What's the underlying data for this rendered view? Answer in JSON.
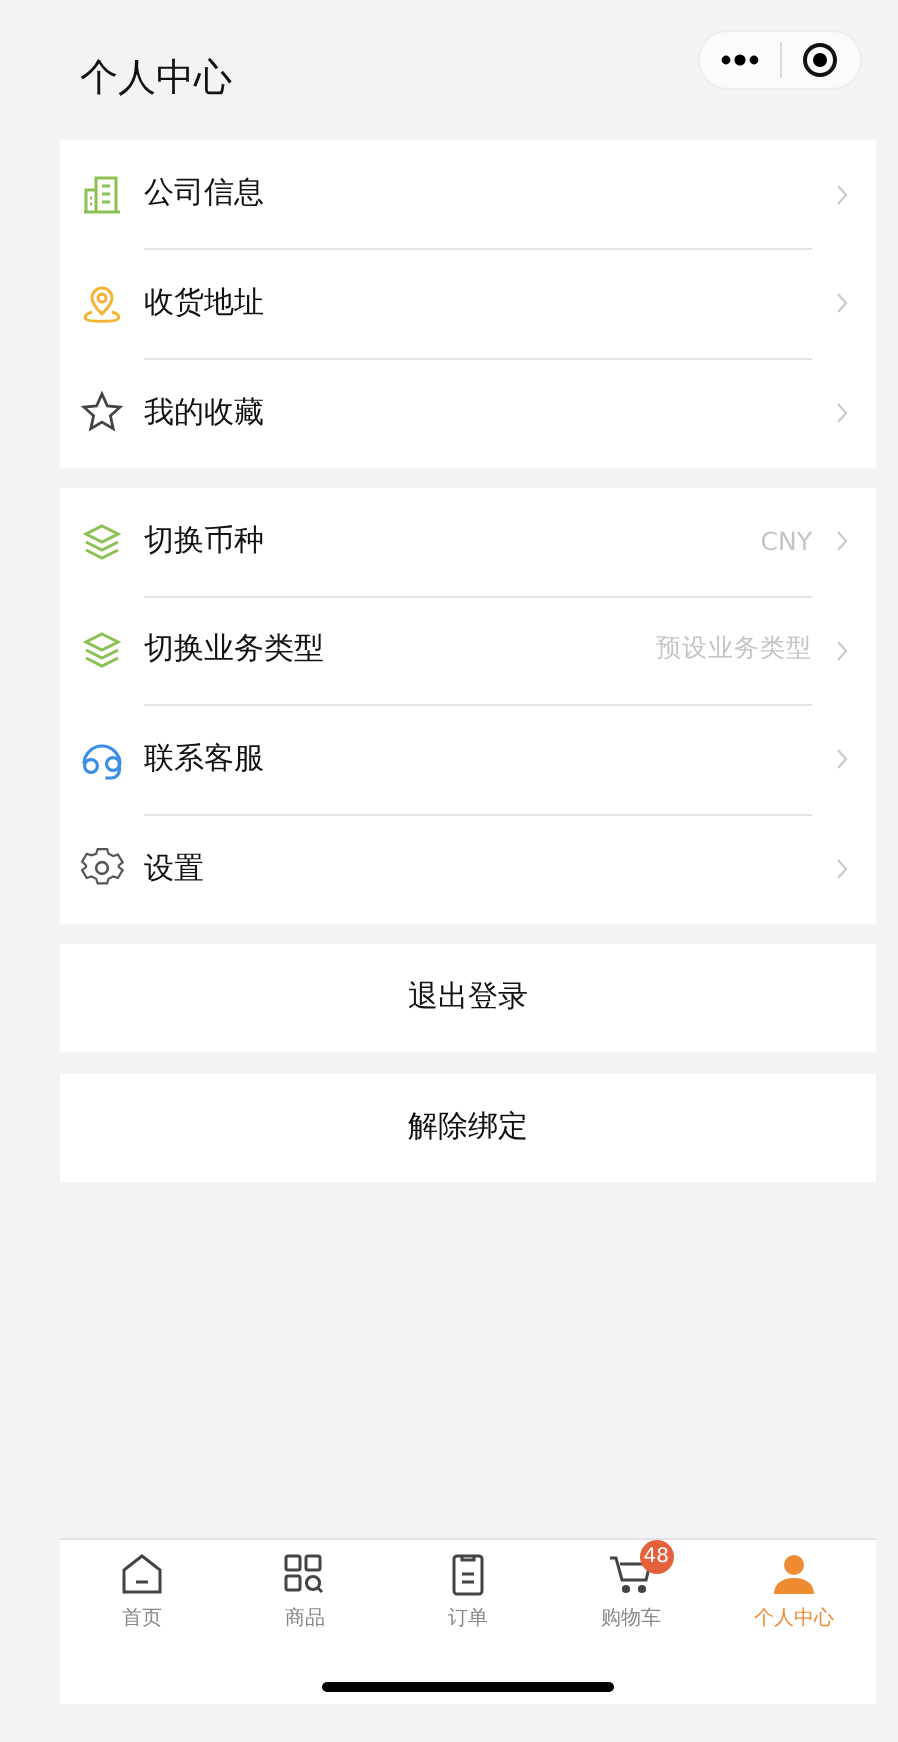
{
  "header": {
    "title": "个人中心"
  },
  "menu_groups": [
    {
      "items": [
        {
          "label": "公司信息"
        },
        {
          "label": "收货地址"
        },
        {
          "label": "我的收藏"
        }
      ]
    },
    {
      "items": [
        {
          "label": "切换币种",
          "value": "CNY"
        },
        {
          "label": "切换业务类型",
          "value": "预设业务类型"
        },
        {
          "label": "联系客服"
        },
        {
          "label": "设置"
        }
      ]
    }
  ],
  "buttons": [
    "退出登录",
    "解除绑定"
  ],
  "tab_bar": [
    {
      "label": "首页",
      "selected": false
    },
    {
      "label": "商品",
      "selected": false
    },
    {
      "label": "订单",
      "selected": false
    },
    {
      "label": "购物车",
      "selected": false,
      "badge": "48"
    },
    {
      "label": "个人中心",
      "selected": true
    }
  ]
}
